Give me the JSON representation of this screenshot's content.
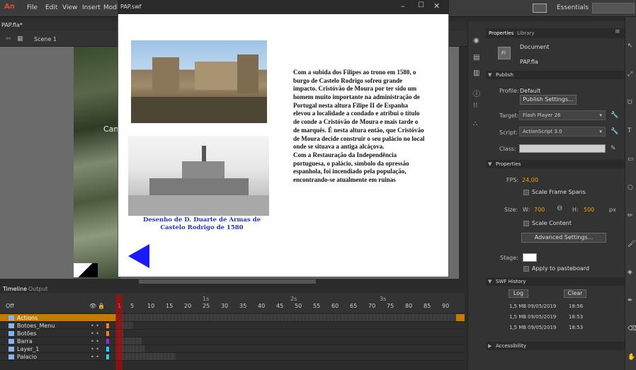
{
  "menubar": {
    "logo": "An",
    "items": [
      "File",
      "Edit",
      "View",
      "Insert",
      "Modi"
    ],
    "workspace": "Essentials"
  },
  "document_tab": "PAP.fla*",
  "scene_label": "Scene 1",
  "stage_text": "Cant",
  "swf_window": {
    "title": "PAP.swf",
    "caption": "Desenho de D. Duarte de Armas de Castelo Rodrigo de 1580",
    "story": [
      "Com a subida dos Filipes ao trono em 1580, o burgo de Castelo Rodrigo sofreu grande impacto. Cristóvão de Moura por ter sido um homem muito importante na administração de Portugal nesta altura Filipe II de Espanha elevou a localidade a condado e atribui o título de conde a Cristóvão de Moura e mais tarde o de marquês. É nesta altura então, que Cristóvão de Moura decide construir o seu palácio no local onde se situava a antiga alcáçova.",
      "Com a Restauração da Independência portuguesa, o palácio, símbolo da opressão espanhola, foi incendiado pela população, encontrando-se atualmente em ruinas"
    ]
  },
  "timeline": {
    "tabs": [
      "Timeline",
      "Output"
    ],
    "off_label": "Off",
    "seconds": [
      "1s",
      "2s",
      "3s"
    ],
    "ruler": [
      "1",
      "5",
      "10",
      "15",
      "20",
      "25",
      "30",
      "35",
      "40",
      "45",
      "50",
      "55",
      "60",
      "65",
      "70",
      "75",
      "80",
      "85",
      "90"
    ],
    "layers": [
      "Actions",
      "Botoes_Menu",
      "Botões",
      "Barra",
      "Layer_1",
      "Palacio"
    ]
  },
  "properties": {
    "tabs": [
      "Properties",
      "Library"
    ],
    "doc_icon_label": "Fl",
    "doc_type": "Document",
    "doc_name": "PAP.fla",
    "publish_head": "Publish",
    "profile_label": "Profile:",
    "profile_value": "Default",
    "publish_settings_button": "Publish Settings...",
    "target_label": "Target:",
    "target_value": "Flash Player 26",
    "script_label": "Script:",
    "script_value": "ActionScript 3.0",
    "class_label": "Class:",
    "properties_head": "Properties",
    "fps_label": "FPS:",
    "fps_value": "24,00",
    "scale_frame_spans": "Scale Frame Spans",
    "size_label": "Size:",
    "w_label": "W:",
    "w_value": "700",
    "h_label": "H:",
    "h_value": "500",
    "unit": "px",
    "scale_content": "Scale Content",
    "advanced_settings_button": "Advanced Settings...",
    "stage_label": "Stage:",
    "apply_to_pasteboard": "Apply to pasteboard",
    "swf_history_head": "SWF History",
    "log_button": "Log",
    "clear_button": "Clear",
    "history": [
      {
        "size": "1,5 MB",
        "date": "09/05/2019",
        "time": "18:56"
      },
      {
        "size": "1,5 MB",
        "date": "09/05/2019",
        "time": "18:53"
      },
      {
        "size": "1,5 MB",
        "date": "09/05/2019",
        "time": "18:53"
      }
    ],
    "accessibility_head": "Accessibility"
  },
  "colors": {
    "caption_blue": "#2233bb",
    "triangle_blue": "#1a1aff",
    "fps_orange": "#f0a000",
    "actions_highlight": "#c57b00"
  }
}
